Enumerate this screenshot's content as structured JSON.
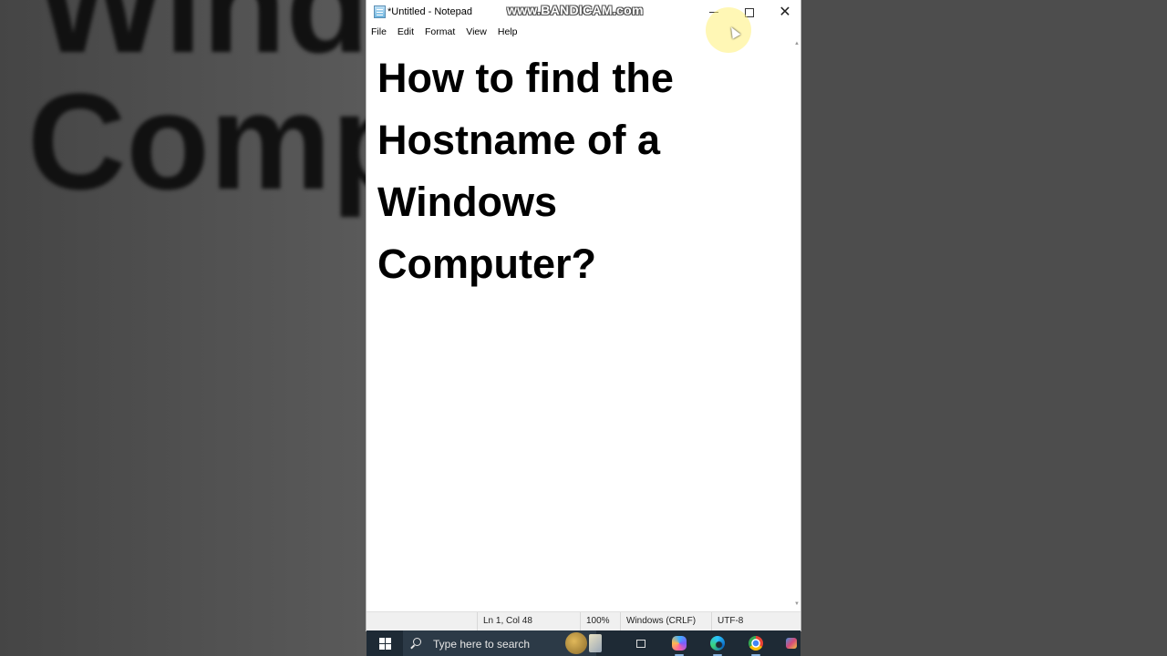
{
  "background": {
    "line1": "Windc",
    "line2": "Comp"
  },
  "window": {
    "title": "*Untitled - Notepad",
    "watermark": "www.BANDICAM.com"
  },
  "menu": {
    "items": [
      "File",
      "Edit",
      "Format",
      "View",
      "Help"
    ]
  },
  "editor": {
    "text": "How to find the Hostname of a Windows Computer?"
  },
  "status": {
    "position": "Ln 1, Col 48",
    "zoom": "100%",
    "line_ending": "Windows (CRLF)",
    "encoding": "UTF-8"
  },
  "taskbar": {
    "search_placeholder": "Type here to search"
  },
  "icons": {
    "app": "notepad-icon",
    "minimize": "minimize-icon",
    "maximize": "maximize-icon",
    "close": "close-icon",
    "start": "windows-logo-icon",
    "search": "search-icon",
    "taskview": "task-view-icon",
    "copilot": "copilot-icon",
    "edge": "edge-icon",
    "chrome": "chrome-icon",
    "resolve": "davinci-resolve-icon"
  }
}
